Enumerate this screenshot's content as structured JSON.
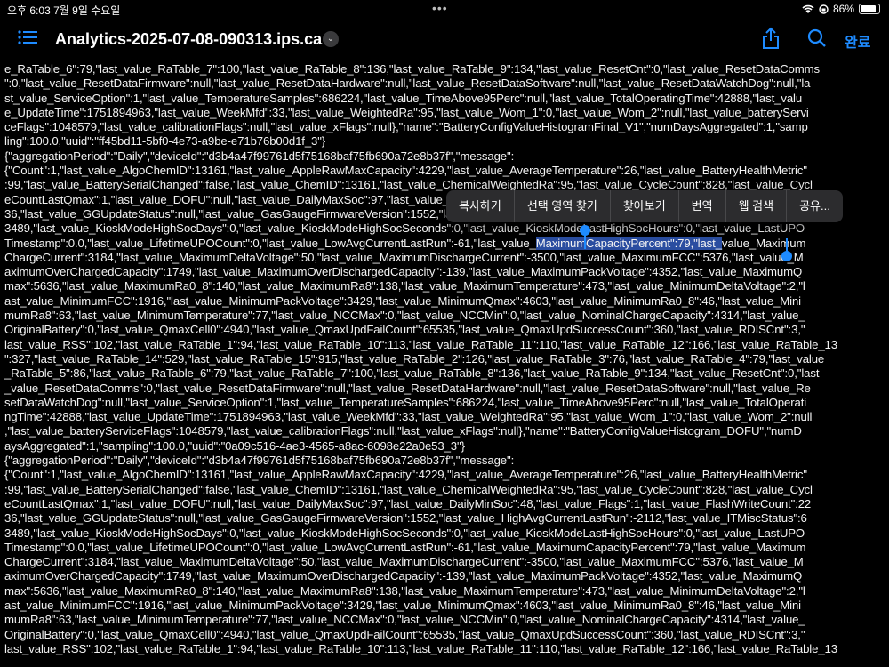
{
  "status": {
    "time": "오후 6:03",
    "date": "7월 9일 수요일",
    "battery": "86%",
    "battery_level": 0.86,
    "dots": "•••"
  },
  "nav": {
    "title": "Analytics-2025-07-08-090313.ips.ca",
    "done": "완료"
  },
  "icons": {
    "list": "list-icon",
    "share": "share-icon",
    "search": "search-icon",
    "chevron": "chevron-down-icon",
    "wifi": "wifi-icon",
    "battery": "battery-icon"
  },
  "colors": {
    "accent": "#1e8bff",
    "selection": "#2a4da0",
    "background": "#000000"
  },
  "menu": {
    "items": [
      "복사하기",
      "선택 영역 찾기",
      "찾아보기",
      "번역",
      "웹 검색",
      "공유..."
    ]
  },
  "content": {
    "lines": [
      "e_RaTable_6\":79,\"last_value_RaTable_7\":100,\"last_value_RaTable_8\":136,\"last_value_RaTable_9\":134,\"last_value_ResetCnt\":0,\"last_value_ResetDataComms",
      "\":0,\"last_value_ResetDataFirmware\":null,\"last_value_ResetDataHardware\":null,\"last_value_ResetDataSoftware\":null,\"last_value_ResetDataWatchDog\":null,\"la",
      "st_value_ServiceOption\":1,\"last_value_TemperatureSamples\":686224,\"last_value_TimeAbove95Perc\":null,\"last_value_TotalOperatingTime\":42888,\"last_valu",
      "e_UpdateTime\":1751894963,\"last_value_WeekMfd\":33,\"last_value_WeightedRa\":95,\"last_value_Wom_1\":0,\"last_value_Wom_2\":null,\"last_value_batteryServi",
      "ceFlags\":1048579,\"last_value_calibrationFlags\":null,\"last_value_xFlags\":null},\"name\":\"BatteryConfigValueHistogramFinal_V1\",\"numDaysAggregated\":1,\"samp",
      "ling\":100.0,\"uuid\":\"ff45bd11-5bf0-4e73-a9be-e71b76b00d1f_3\"}",
      "{\"aggregationPeriod\":\"Daily\",\"deviceId\":\"d3b4a47f99761d5f75168baf75fb690a72e8b37f\",\"message\":",
      "{\"Count\":1,\"last_value_AlgoChemID\":13161,\"last_value_AppleRawMaxCapacity\":4229,\"last_value_AverageTemperature\":26,\"last_value_BatteryHealthMetric\"",
      ":99,\"last_value_BatterySerialChanged\":false,\"last_value_ChemID\":13161,\"last_value_ChemicalWeightedRa\":95,\"last_value_CycleCount\":828,\"last_value_Cycl",
      "eCountLastQmax\":1,\"last_value_DOFU\":null,\"last_value_DailyMaxSoc\":97,\"last_value_DailyMinSoc\":48,\"last_value_Flags\":1,\"last_value_FlashWriteCount\":22",
      "36,\"last_value_GGUpdateStatus\":null,\"last_value_GasGaugeFirmwareVersion\":1552,\"last_value_HighAvgCurrentLastRun\":-2112,\"last_value_ITMiscStatus\":6",
      "3489,\"last_value_KioskModeHighSocDays\":0,\"last_value_KioskModeHighSocSeconds\":0,\"last_value_KioskModeLastHighSocHours\":0,\"last_value_LastUPO",
      "Timestamp\":0.0,\"last_value_LifetimeUPOCount\":0,\"last_value_LowAvgCurrentLastRun\":-61,\"last_value_",
      "ChargeCurrent\":3184,\"last_value_MaximumDeltaVoltage\":50,\"last_value_MaximumDischargeCurrent\":-3500,\"last_value_MaximumFCC\":5376,\"last_value_M",
      "aximumOverChargedCapacity\":1749,\"last_value_MaximumOverDischargedCapacity\":-139,\"last_value_MaximumPackVoltage\":4352,\"last_value_MaximumQ",
      "max\":5636,\"last_value_MaximumRa0_8\":140,\"last_value_MaximumRa8\":138,\"last_value_MaximumTemperature\":473,\"last_value_MinimumDeltaVoltage\":2,\"l",
      "ast_value_MinimumFCC\":1916,\"last_value_MinimumPackVoltage\":3429,\"last_value_MinimumQmax\":4603,\"last_value_MinimumRa0_8\":46,\"last_value_Mini",
      "mumRa8\":63,\"last_value_MinimumTemperature\":77,\"last_value_NCCMax\":0,\"last_value_NCCMin\":0,\"last_value_NominalChargeCapacity\":4314,\"last_value_",
      "OriginalBattery\":0,\"last_value_QmaxCell0\":4940,\"last_value_QmaxUpdFailCount\":65535,\"last_value_QmaxUpdSuccessCount\":360,\"last_value_RDISCnt\":3,\"",
      "last_value_RSS\":102,\"last_value_RaTable_1\":94,\"last_value_RaTable_10\":113,\"last_value_RaTable_11\":110,\"last_value_RaTable_12\":166,\"last_value_RaTable_13",
      "\":327,\"last_value_RaTable_14\":529,\"last_value_RaTable_15\":915,\"last_value_RaTable_2\":126,\"last_value_RaTable_3\":76,\"last_value_RaTable_4\":79,\"last_value",
      "_RaTable_5\":86,\"last_value_RaTable_6\":79,\"last_value_RaTable_7\":100,\"last_value_RaTable_8\":136,\"last_value_RaTable_9\":134,\"last_value_ResetCnt\":0,\"last",
      "_value_ResetDataComms\":0,\"last_value_ResetDataFirmware\":null,\"last_value_ResetDataHardware\":null,\"last_value_ResetDataSoftware\":null,\"last_value_Re",
      "setDataWatchDog\":null,\"last_value_ServiceOption\":1,\"last_value_TemperatureSamples\":686224,\"last_value_TimeAbove95Perc\":null,\"last_value_TotalOperati",
      "ngTime\":42888,\"last_value_UpdateTime\":1751894963,\"last_value_WeekMfd\":33,\"last_value_WeightedRa\":95,\"last_value_Wom_1\":0,\"last_value_Wom_2\":null",
      ",\"last_value_batteryServiceFlags\":1048579,\"last_value_calibrationFlags\":null,\"last_value_xFlags\":null},\"name\":\"BatteryConfigValueHistogram_DOFU\",\"numD",
      "aysAggregated\":1,\"sampling\":100.0,\"uuid\":\"0a09c516-4ae3-4565-a8ac-6098e22a0e53_3\"}",
      "{\"aggregationPeriod\":\"Daily\",\"deviceId\":\"d3b4a47f99761d5f75168baf75fb690a72e8b37f\",\"message\":",
      "{\"Count\":1,\"last_value_AlgoChemID\":13161,\"last_value_AppleRawMaxCapacity\":4229,\"last_value_AverageTemperature\":26,\"last_value_BatteryHealthMetric\"",
      ":99,\"last_value_BatterySerialChanged\":false,\"last_value_ChemID\":13161,\"last_value_ChemicalWeightedRa\":95,\"last_value_CycleCount\":828,\"last_value_Cycl",
      "eCountLastQmax\":1,\"last_value_DOFU\":null,\"last_value_DailyMaxSoc\":97,\"last_value_DailyMinSoc\":48,\"last_value_Flags\":1,\"last_value_FlashWriteCount\":22",
      "36,\"last_value_GGUpdateStatus\":null,\"last_value_GasGaugeFirmwareVersion\":1552,\"last_value_HighAvgCurrentLastRun\":-2112,\"last_value_ITMiscStatus\":6",
      "3489,\"last_value_KioskModeHighSocDays\":0,\"last_value_KioskModeHighSocSeconds\":0,\"last_value_KioskModeLastHighSocHours\":0,\"last_value_LastUPO",
      "Timestamp\":0.0,\"last_value_LifetimeUPOCount\":0,\"last_value_LowAvgCurrentLastRun\":-61,\"last_value_MaximumCapacityPercent\":79,\"last_value_Maximum",
      "ChargeCurrent\":3184,\"last_value_MaximumDeltaVoltage\":50,\"last_value_MaximumDischargeCurrent\":-3500,\"last_value_MaximumFCC\":5376,\"last_value_M",
      "aximumOverChargedCapacity\":1749,\"last_value_MaximumOverDischargedCapacity\":-139,\"last_value_MaximumPackVoltage\":4352,\"last_value_MaximumQ",
      "max\":5636,\"last_value_MaximumRa0_8\":140,\"last_value_MaximumRa8\":138,\"last_value_MaximumTemperature\":473,\"last_value_MinimumDeltaVoltage\":2,\"l",
      "ast_value_MinimumFCC\":1916,\"last_value_MinimumPackVoltage\":3429,\"last_value_MinimumQmax\":4603,\"last_value_MinimumRa0_8\":46,\"last_value_Mini",
      "mumRa8\":63,\"last_value_MinimumTemperature\":77,\"last_value_NCCMax\":0,\"last_value_NCCMin\":0,\"last_value_NominalChargeCapacity\":4314,\"last_value_",
      "OriginalBattery\":0,\"last_value_QmaxCell0\":4940,\"last_value_QmaxUpdFailCount\":65535,\"last_value_QmaxUpdSuccessCount\":360,\"last_value_RDISCnt\":3,\"",
      "last_value_RSS\":102,\"last_value_RaTable_1\":94,\"last_value_RaTable_10\":113,\"last_value_RaTable_11\":110,\"last_value_RaTable_12\":166,\"last_value_RaTable_13"
    ],
    "selection_text": "MaximumCapacityPercent\":79,\"last_",
    "selection_tail": "value_Maximum"
  }
}
